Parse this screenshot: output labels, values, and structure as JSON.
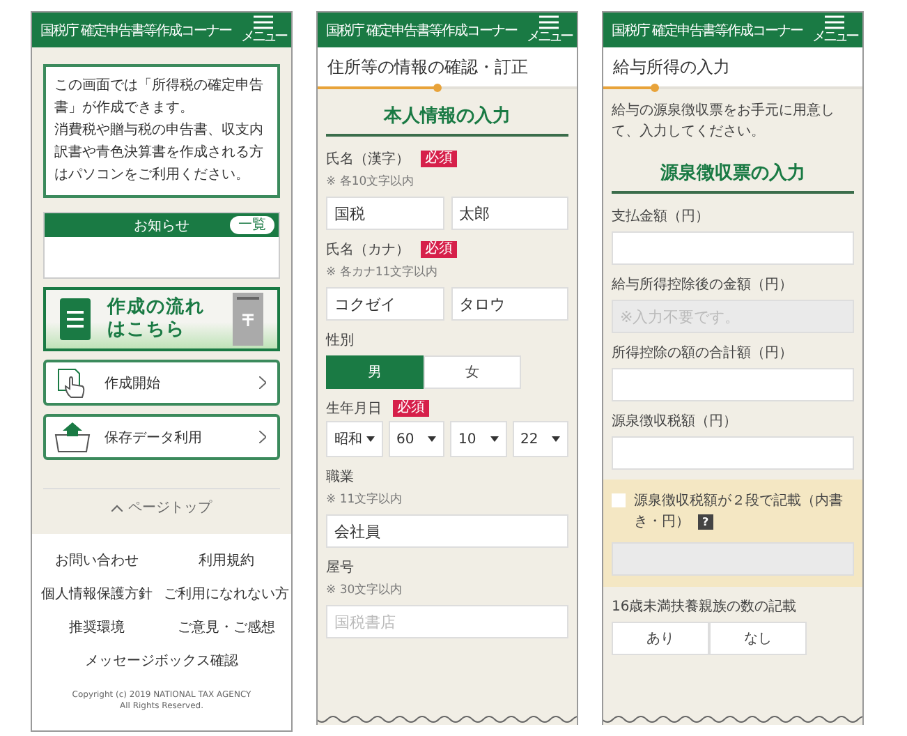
{
  "home": {
    "header": {
      "title": "国税庁 確定申告書等作成コーナー",
      "menu_label": "メニュー"
    },
    "intro": [
      "この画面では「所得税の確定申告書」が作成できます。",
      "消費税や贈与税の申告書、収支内訳書や青色決算書を作成される方はパソコンをご利用ください。"
    ],
    "notice": {
      "title": "お知らせ",
      "list_button": "一覧"
    },
    "banner": {
      "text": "作成の流れはこちら"
    },
    "actions": [
      {
        "kind": "new",
        "label": "作成開始"
      },
      {
        "kind": "upload",
        "label": "保存データ利用"
      }
    ],
    "page_top": "ページトップ",
    "footer_links": [
      "お問い合わせ",
      "利用規約",
      "個人情報保護方針",
      "ご利用になれない方",
      "推奨環境",
      "ご意見・ご感想",
      "メッセージボックス確認"
    ],
    "copyright": [
      "Copyright (c) 2019 NATIONAL TAX AGENCY",
      "All Rights Reserved."
    ]
  },
  "personal_info": {
    "header": {
      "title": "国税庁 確定申告書等作成コーナー",
      "menu_label": "メニュー"
    },
    "subtitle": "住所等の情報の確認・訂正",
    "progress": {
      "level": 0.46
    },
    "heading": "本人情報の入力",
    "fields": [
      {
        "kind": "text",
        "label": "氏名（漢字）",
        "badge": "必須",
        "note": "※ 各10文字以内",
        "inputs": [
          {
            "value": "国税",
            "disabled": false
          },
          {
            "value": "太郎",
            "disabled": false
          }
        ]
      },
      {
        "kind": "text",
        "label": "氏名（カナ）",
        "badge": "必須",
        "note": "※ 各カナ11文字以内",
        "inputs": [
          {
            "value": "コクゼイ",
            "disabled": false
          },
          {
            "value": "タロウ",
            "disabled": false
          }
        ]
      },
      {
        "kind": "segmented",
        "label": "性別",
        "options": [
          {
            "label": "男",
            "selected": true
          },
          {
            "label": "女",
            "selected": false
          }
        ]
      },
      {
        "kind": "selects",
        "label": "生年月日",
        "badge": "必須",
        "selects": [
          "昭和",
          "60",
          "10",
          "22"
        ]
      },
      {
        "kind": "text",
        "label": "職業",
        "note": "※ 11文字以内",
        "inputs": [
          {
            "value": "会社員",
            "disabled": false
          }
        ]
      },
      {
        "kind": "text",
        "label": "屋号",
        "note": "※ 30文字以内",
        "inputs": [
          {
            "placeholder": "国税書店",
            "disabled": false
          }
        ]
      }
    ]
  },
  "salary_income": {
    "header": {
      "title": "国税庁 確定申告書等作成コーナー",
      "menu_label": "メニュー"
    },
    "subtitle": "給与所得の入力",
    "progress": {
      "level": 0.2
    },
    "intro": "給与の源泉徴収票をお手元に用意して、入力してください。",
    "heading": "源泉徴収票の入力",
    "fields": [
      {
        "kind": "text",
        "label": "支払金額（円）",
        "inputs": [
          {
            "disabled": false
          }
        ]
      },
      {
        "kind": "text",
        "label": "給与所得控除後の金額（円）",
        "inputs": [
          {
            "placeholder": "※入力不要です。",
            "disabled": true
          }
        ]
      },
      {
        "kind": "text",
        "label": "所得控除の額の合計額（円）",
        "inputs": [
          {
            "disabled": false
          }
        ]
      },
      {
        "kind": "text",
        "label": "源泉徴収税額（円）",
        "inputs": [
          {
            "disabled": false
          }
        ]
      },
      {
        "kind": "checkbox",
        "label": "源泉徴収税額が２段で記載（内書き・円）",
        "checked": false,
        "help": "?",
        "inputs": [
          {
            "disabled": true
          }
        ]
      },
      {
        "kind": "segmented",
        "label": "16歳未満扶養親族の数の記載",
        "options": [
          {
            "label": "あり",
            "selected": false
          },
          {
            "label": "なし",
            "selected": false
          }
        ]
      }
    ]
  }
}
